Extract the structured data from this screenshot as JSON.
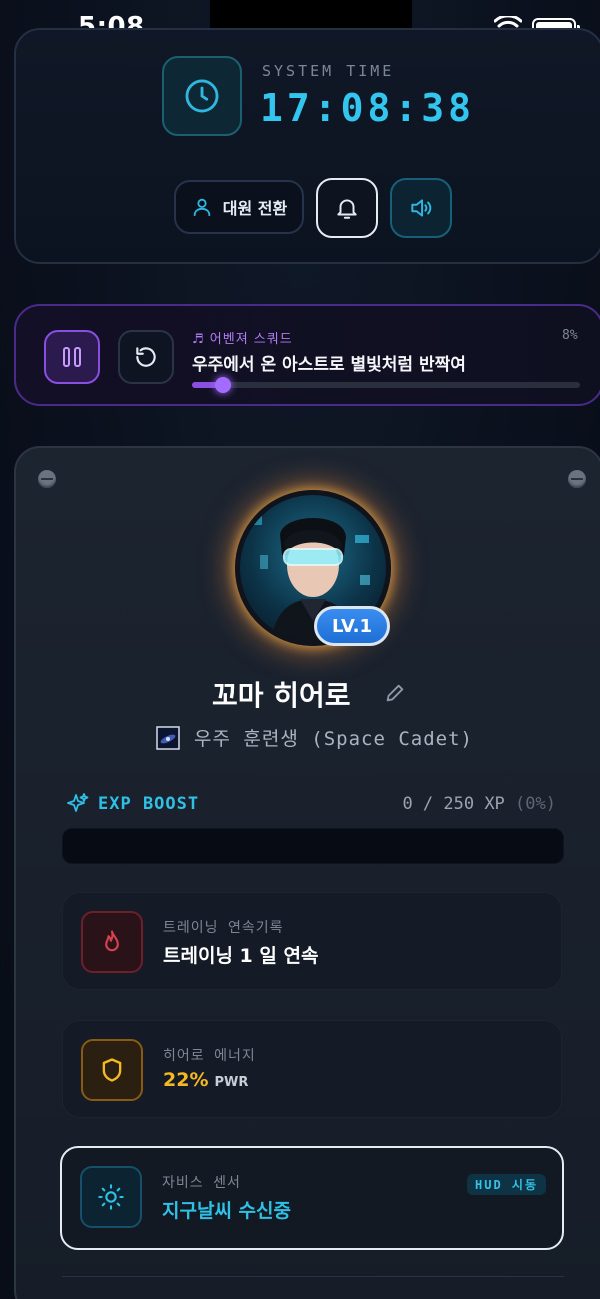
{
  "status_bar": {
    "time": "5:08"
  },
  "clock_panel": {
    "label": "SYSTEM TIME",
    "time": "17:08:38",
    "switch_button_label": "대원 전환"
  },
  "music": {
    "playlist": "♬ 어벤져 스쿼드",
    "title": "우주에서 온 아스트로 별빛처럼 반짝여",
    "percent_label": "8%",
    "progress": 0.08
  },
  "profile": {
    "level": "LV.1",
    "name": "꼬마 히어로",
    "title": "우주 훈련생 (Space Cadet)",
    "exp": {
      "label": "EXP BOOST",
      "value": "0 / 250 XP",
      "percent": "(0%)",
      "progress": 0
    },
    "streak": {
      "label": "트레이닝 연속기록",
      "value": "트레이닝 1 일 연속"
    },
    "energy": {
      "label": "히어로 에너지",
      "value": "22%",
      "unit": "PWR"
    },
    "jarvis": {
      "label": "자비스 센서",
      "value": "지구날씨 수신중",
      "badge": "HUD 시동"
    }
  },
  "colors": {
    "accent_cyan": "#2fc0e6",
    "accent_purple": "#8a4fe0",
    "energy_yellow": "#f5b820",
    "streak_red": "#d9414f"
  },
  "icons": [
    "clock-icon",
    "user-icon",
    "bell-icon",
    "speaker-icon",
    "pause-icon",
    "replay-icon",
    "edit-icon",
    "galaxy-image-icon",
    "sparkle-icon",
    "flame-icon",
    "shield-icon",
    "sun-icon"
  ]
}
